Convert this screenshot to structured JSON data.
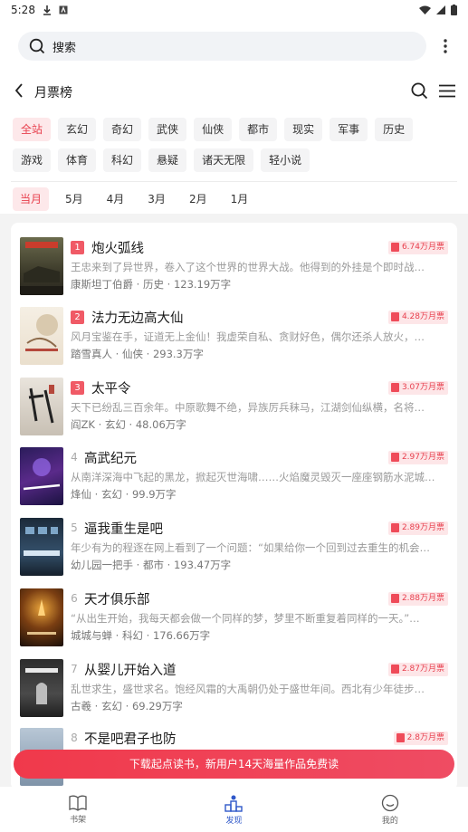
{
  "status": {
    "time": "5:28"
  },
  "search": {
    "placeholder": "搜索"
  },
  "header": {
    "title": "月票榜"
  },
  "categories": [
    "全站",
    "玄幻",
    "奇幻",
    "武侠",
    "仙侠",
    "都市",
    "现实",
    "军事",
    "历史",
    "游戏",
    "体育",
    "科幻",
    "悬疑",
    "诸天无限",
    "轻小说"
  ],
  "months": [
    "当月",
    "5月",
    "4月",
    "3月",
    "2月",
    "1月"
  ],
  "books": [
    {
      "rank": "1",
      "title": "炮火弧线",
      "votes": "6.74万月票",
      "desc": "王忠来到了异世界，卷入了这个世界的世界大战。他得到的外挂是个即时战…",
      "author": "康斯坦丁伯爵",
      "genre": "历史",
      "words": "123.19万字"
    },
    {
      "rank": "2",
      "title": "法力无边高大仙",
      "votes": "4.28万月票",
      "desc": "风月宝鉴在手，证道无上金仙！我虚荣自私、贪财好色，偶尔还杀人放火，…",
      "author": "踏雪真人",
      "genre": "仙侠",
      "words": "293.3万字"
    },
    {
      "rank": "3",
      "title": "太平令",
      "votes": "3.07万月票",
      "desc": "天下已纷乱三百余年。中原歌舞不绝，异族厉兵秣马，江湖剑仙纵横，名将…",
      "author": "阎ZK",
      "genre": "玄幻",
      "words": "48.06万字"
    },
    {
      "rank": "4",
      "title": "高武纪元",
      "votes": "2.97万月票",
      "desc": "从南洋深海中飞起的黑龙，掀起灭世海啸……火焰魔灵毁灭一座座钢筋水泥城…",
      "author": "烽仙",
      "genre": "玄幻",
      "words": "99.9万字"
    },
    {
      "rank": "5",
      "title": "逼我重生是吧",
      "votes": "2.89万月票",
      "desc": "年少有为的程逐在网上看到了一个问题：“如果给你一个回到过去重生的机会…",
      "author": "幼儿园一把手",
      "genre": "都市",
      "words": "193.47万字"
    },
    {
      "rank": "6",
      "title": "天才俱乐部",
      "votes": "2.88万月票",
      "desc": "“从出生开始，我每天都会做一个同样的梦，梦里不断重复着同样的一天。”…",
      "author": "城城与蝉",
      "genre": "科幻",
      "words": "176.66万字"
    },
    {
      "rank": "7",
      "title": "从婴儿开始入道",
      "votes": "2.87万月票",
      "desc": "乱世求生，盛世求名。饱经风霜的大禹朝仍处于盛世年间。西北有少年徒步…",
      "author": "古羲",
      "genre": "玄幻",
      "words": "69.29万字"
    },
    {
      "rank": "8",
      "title": "不是吧君子也防",
      "votes": "2.8万月票",
      "desc": "",
      "author": "",
      "genre": "",
      "words": ""
    }
  ],
  "promo": {
    "text": "下载起点读书，新用户14天海量作品免费读"
  },
  "nav": [
    {
      "label": "书架"
    },
    {
      "label": "发现"
    },
    {
      "label": "我的"
    }
  ],
  "colors": {
    "accent": "#e8404e",
    "nav_active": "#2f58c9"
  }
}
